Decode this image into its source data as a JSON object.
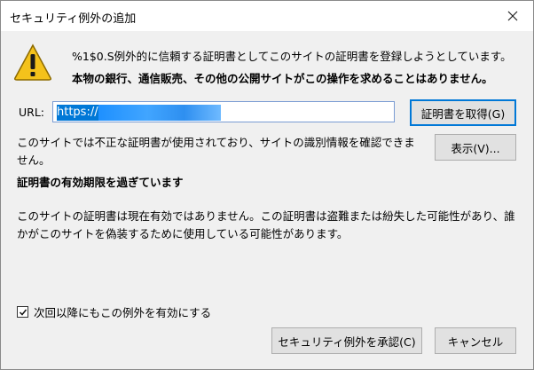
{
  "window": {
    "title": "セキュリティ例外の追加"
  },
  "icons": {
    "close": "close-icon",
    "warning": "warning-icon",
    "check": "checkmark-icon"
  },
  "header": {
    "line1": "%1$0.S例外的に信頼する証明書としてこのサイトの証明書を登録しようとしています。",
    "line2": "本物の銀行、通信販売、その他の公開サイトがこの操作を求めることはありません。"
  },
  "url": {
    "label": "URL:",
    "value": "https://"
  },
  "buttons": {
    "get_cert": "証明書を取得(G)",
    "view": "表示(V)...",
    "confirm": "セキュリティ例外を承認(C)",
    "cancel": "キャンセル"
  },
  "status": {
    "description": "このサイトでは不正な証明書が使用されており、サイトの識別情報を確認できません。",
    "heading": "証明書の有効期限を過ぎています",
    "detail": "このサイトの証明書は現在有効ではありません。この証明書は盗難または紛失した可能性があり、誰かがこのサイトを偽装するために使用している可能性があります。"
  },
  "checkbox": {
    "label": "次回以降にもこの例外を有効にする",
    "checked": true
  },
  "colors": {
    "accent": "#0078d7",
    "warning": "#f4c21b"
  }
}
